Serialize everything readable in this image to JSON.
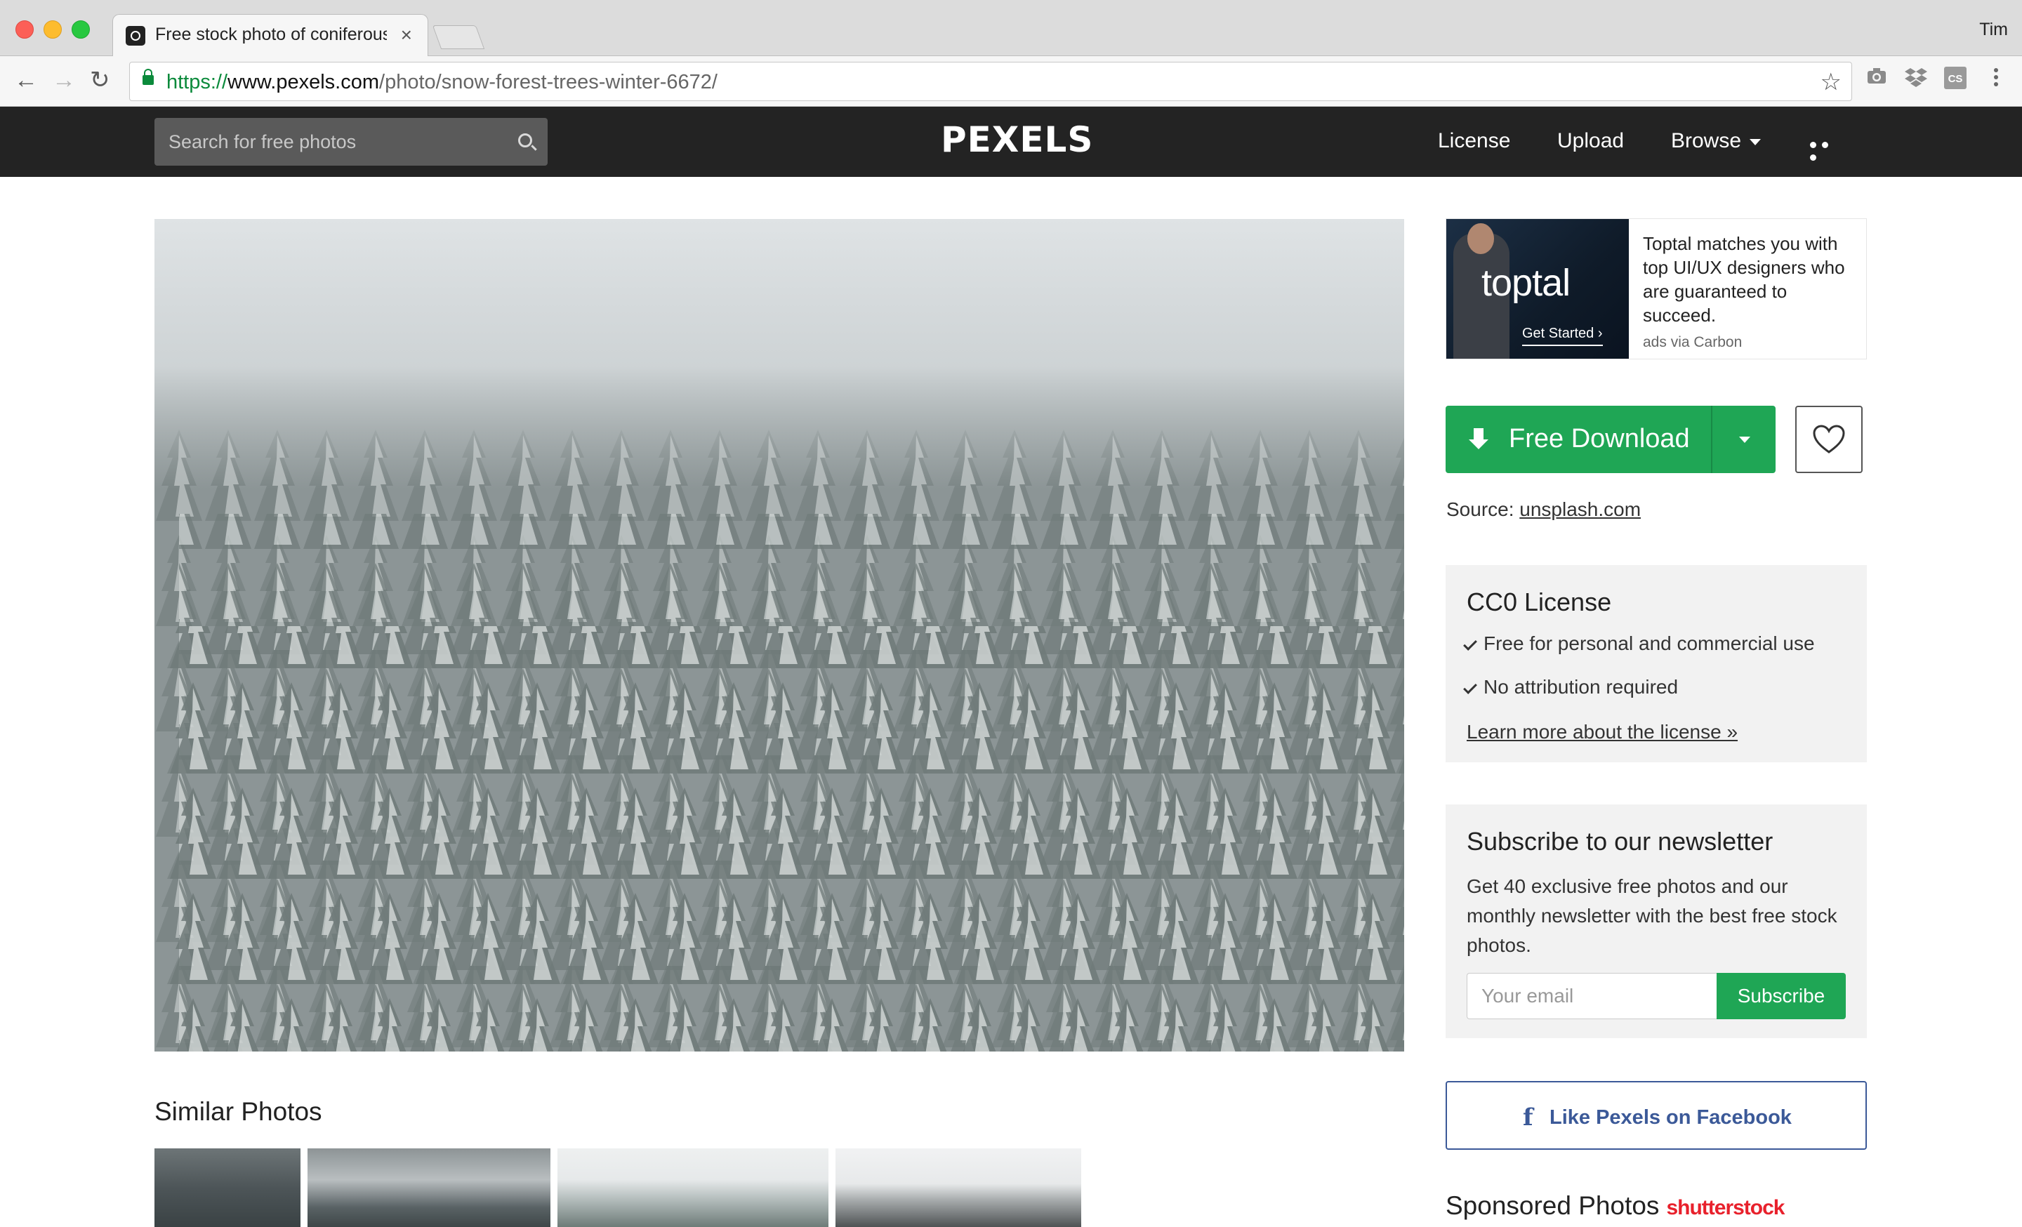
{
  "browser": {
    "tab_title": "Free stock photo of coniferous",
    "profile_name": "Tim",
    "url_scheme": "https://",
    "url_host": "www.pexels.com",
    "url_path": "/photo/snow-forest-trees-winter-6672/"
  },
  "header": {
    "search_placeholder": "Search for free photos",
    "logo": "PEXELS",
    "nav": {
      "license": "License",
      "upload": "Upload",
      "browse": "Browse"
    }
  },
  "ad": {
    "brand": "toptal",
    "cta": "Get Started ›",
    "text": "Toptal matches you with top UI/UX designers who are guaranteed to succeed.",
    "via": "ads via Carbon"
  },
  "download": {
    "label": "Free Download"
  },
  "source": {
    "label": "Source:",
    "link": "unsplash.com"
  },
  "license": {
    "title": "CC0 License",
    "items": [
      "Free for personal and commercial use",
      "No attribution required"
    ],
    "link": "Learn more about the license »"
  },
  "newsletter": {
    "title": "Subscribe to our newsletter",
    "text": "Get 40 exclusive free photos and our monthly newsletter with the best free stock photos.",
    "email_placeholder": "Your email",
    "button": "Subscribe"
  },
  "facebook": {
    "icon": "f",
    "label": "Like Pexels on Facebook"
  },
  "sponsored": {
    "title": "Sponsored Photos",
    "provider": "shutterstock"
  },
  "similar": {
    "title": "Similar Photos"
  },
  "colors": {
    "accent_green": "#1fa655",
    "header_dark": "#232323",
    "facebook_blue": "#3b5998"
  }
}
